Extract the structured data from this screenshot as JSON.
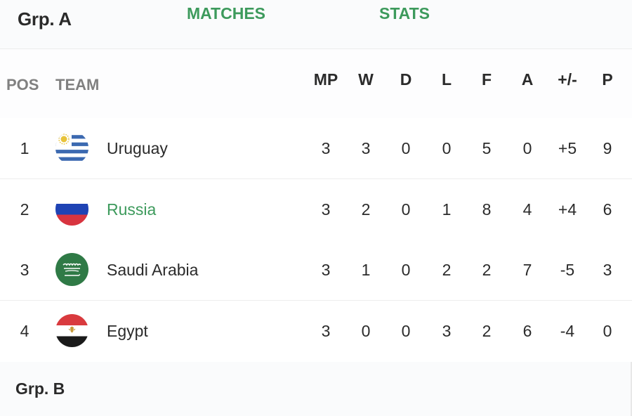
{
  "group_a": {
    "title": "Grp. A",
    "tabs": {
      "matches": "MATCHES",
      "stats": "STATS"
    },
    "columns": {
      "pos": "POS",
      "team": "TEAM",
      "mp": "MP",
      "w": "W",
      "d": "D",
      "l": "L",
      "f": "F",
      "a": "A",
      "gd": "+/-",
      "p": "P"
    },
    "rows": [
      {
        "pos": "1",
        "team": "Uruguay",
        "flag": "uruguay-flag",
        "mp": "3",
        "w": "3",
        "d": "0",
        "l": "0",
        "f": "5",
        "a": "0",
        "gd": "+5",
        "p": "9"
      },
      {
        "pos": "2",
        "team": "Russia",
        "flag": "russia-flag",
        "mp": "3",
        "w": "2",
        "d": "0",
        "l": "1",
        "f": "8",
        "a": "4",
        "gd": "+4",
        "p": "6"
      },
      {
        "pos": "3",
        "team": "Saudi Arabia",
        "flag": "saudi-arabia-flag",
        "mp": "3",
        "w": "1",
        "d": "0",
        "l": "2",
        "f": "2",
        "a": "7",
        "gd": "-5",
        "p": "3"
      },
      {
        "pos": "4",
        "team": "Egypt",
        "flag": "egypt-flag",
        "mp": "3",
        "w": "0",
        "d": "0",
        "l": "3",
        "f": "2",
        "a": "6",
        "gd": "-4",
        "p": "0"
      }
    ]
  },
  "group_b": {
    "title": "Grp. B"
  },
  "colors": {
    "accent": "#3d9a5c",
    "header_text": "#808080"
  }
}
